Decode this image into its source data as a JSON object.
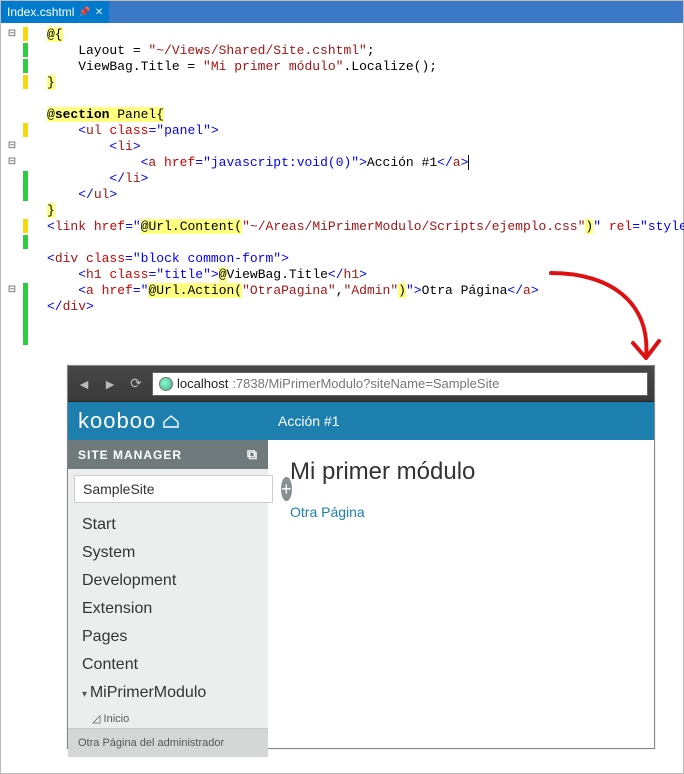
{
  "tab": {
    "name": "Index.cshtml"
  },
  "code": {
    "l1a": "@{",
    "l2a": "    Layout = ",
    "l2b": "\"~/Views/Shared/Site.cshtml\"",
    "l2c": ";",
    "l3a": "    ViewBag.Title = ",
    "l3b": "\"Mi primer módulo\"",
    "l3c": ".Localize();",
    "l4a": "}",
    "l6a": "@",
    "l6b": "section",
    "l6c": " Panel{",
    "l7a": "    <",
    "l7b": "ul",
    "l7c": " ",
    "l7d": "class",
    "l7e": "=",
    "l7f": "\"panel\"",
    "l7g": ">",
    "l8a": "        <",
    "l8b": "li",
    "l8c": ">",
    "l9a": "            <",
    "l9b": "a",
    "l9c": " ",
    "l9d": "href",
    "l9e": "=",
    "l9f": "\"javascript:void(0)\"",
    "l9g": ">",
    "l9h": "Acción #1",
    "l9i": "</",
    "l9j": "a",
    "l9k": ">",
    "l10a": "        </",
    "l10b": "li",
    "l10c": ">",
    "l11a": "    </",
    "l11b": "ul",
    "l11c": ">",
    "l12a": "}",
    "l13a": "<",
    "l13b": "link",
    "l13c": " ",
    "l13d": "href",
    "l13e": "=",
    "l13f": "\"",
    "l13u": "@Url.Content(",
    "l13s": "\"~/Areas/MiPrimerModulo/Scripts/ejemplo.css\"",
    "l13v": ")",
    "l13g": "\"",
    "l13h": " ",
    "l13i": "rel",
    "l13j": "=",
    "l13k": "\"stylesheet\"",
    "l13l": " />",
    "l15a": "<",
    "l15b": "div",
    "l15c": " ",
    "l15d": "class",
    "l15e": "=",
    "l15f": "\"block common-form\"",
    "l15g": ">",
    "l16a": "    <",
    "l16b": "h1",
    "l16c": " ",
    "l16d": "class",
    "l16e": "=",
    "l16f": "\"title\"",
    "l16g": ">",
    "l16h": "@",
    "l16i": "ViewBag.Title",
    "l16j": "</",
    "l16k": "h1",
    "l16l": ">",
    "l17a": "    <",
    "l17b": "a",
    "l17c": " ",
    "l17d": "href",
    "l17e": "=",
    "l17f": "\"",
    "l17u": "@Url.Action(",
    "l17s1": "\"OtraPagina\"",
    "l17w": ",",
    "l17s2": "\"Admin\"",
    "l17v": ")",
    "l17g": "\"",
    "l17h": ">",
    "l17i": "Otra Página",
    "l17j": "</",
    "l17k": "a",
    "l17l": ">",
    "l18a": "</",
    "l18b": "div",
    "l18c": ">"
  },
  "browser": {
    "host": "localhost",
    "path": ":7838/MiPrimerModulo?siteName=SampleSite",
    "strip_action": "Acción #1",
    "logo": "kooboo",
    "sitemanager": "SITE MANAGER",
    "siteinput": "SampleSite",
    "menu": [
      "Start",
      "System",
      "Development",
      "Extension",
      "Pages",
      "Content",
      "MiPrimerModulo"
    ],
    "subitem": "Inicio",
    "bottombar": "Otra Página del administrador",
    "h1": "Mi primer módulo",
    "link": "Otra Página"
  }
}
